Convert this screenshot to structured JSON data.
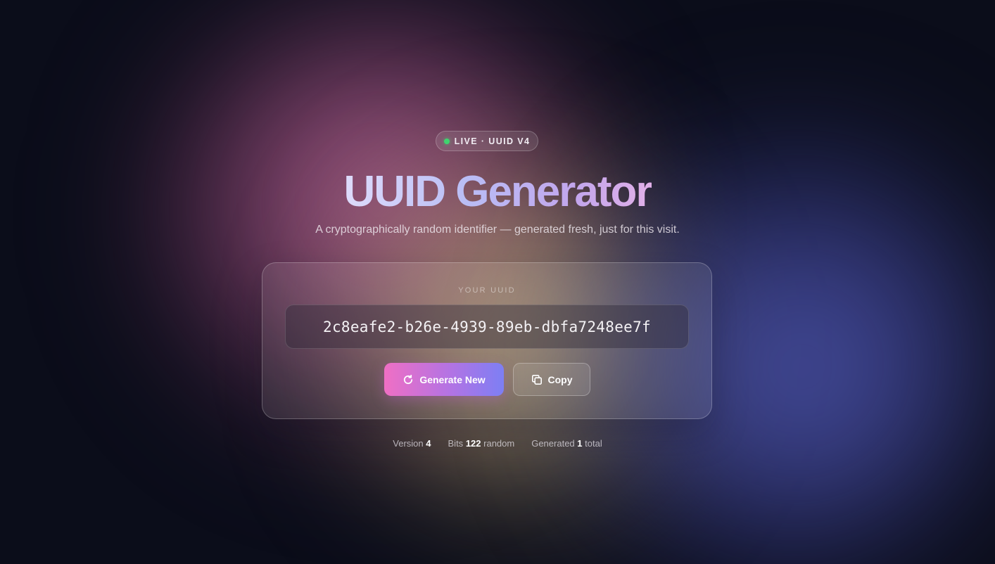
{
  "badge": {
    "text": "LIVE · UUID V4",
    "dot_color": "#3fd46f"
  },
  "header": {
    "title": "UUID Generator",
    "subtitle": "A cryptographically random identifier — generated fresh, just for this visit."
  },
  "card": {
    "label": "YOUR UUID",
    "uuid": "2c8eafe2-b26e-4939-89eb-dbfa7248ee7f"
  },
  "actions": {
    "generate_label": "Generate New",
    "generate_icon": "refresh-icon",
    "copy_label": "Copy",
    "copy_icon": "copy-icon"
  },
  "stats": {
    "version_label": "Version",
    "version_value": "4",
    "bits_label": "Bits",
    "bits_value": "122",
    "bits_suffix": "random",
    "generated_label": "Generated",
    "generated_value": "1",
    "generated_suffix": "total"
  },
  "colors": {
    "background": "#0b0d1a",
    "accent_pink": "#ef6fc4",
    "accent_blue": "#7d7ff4"
  }
}
